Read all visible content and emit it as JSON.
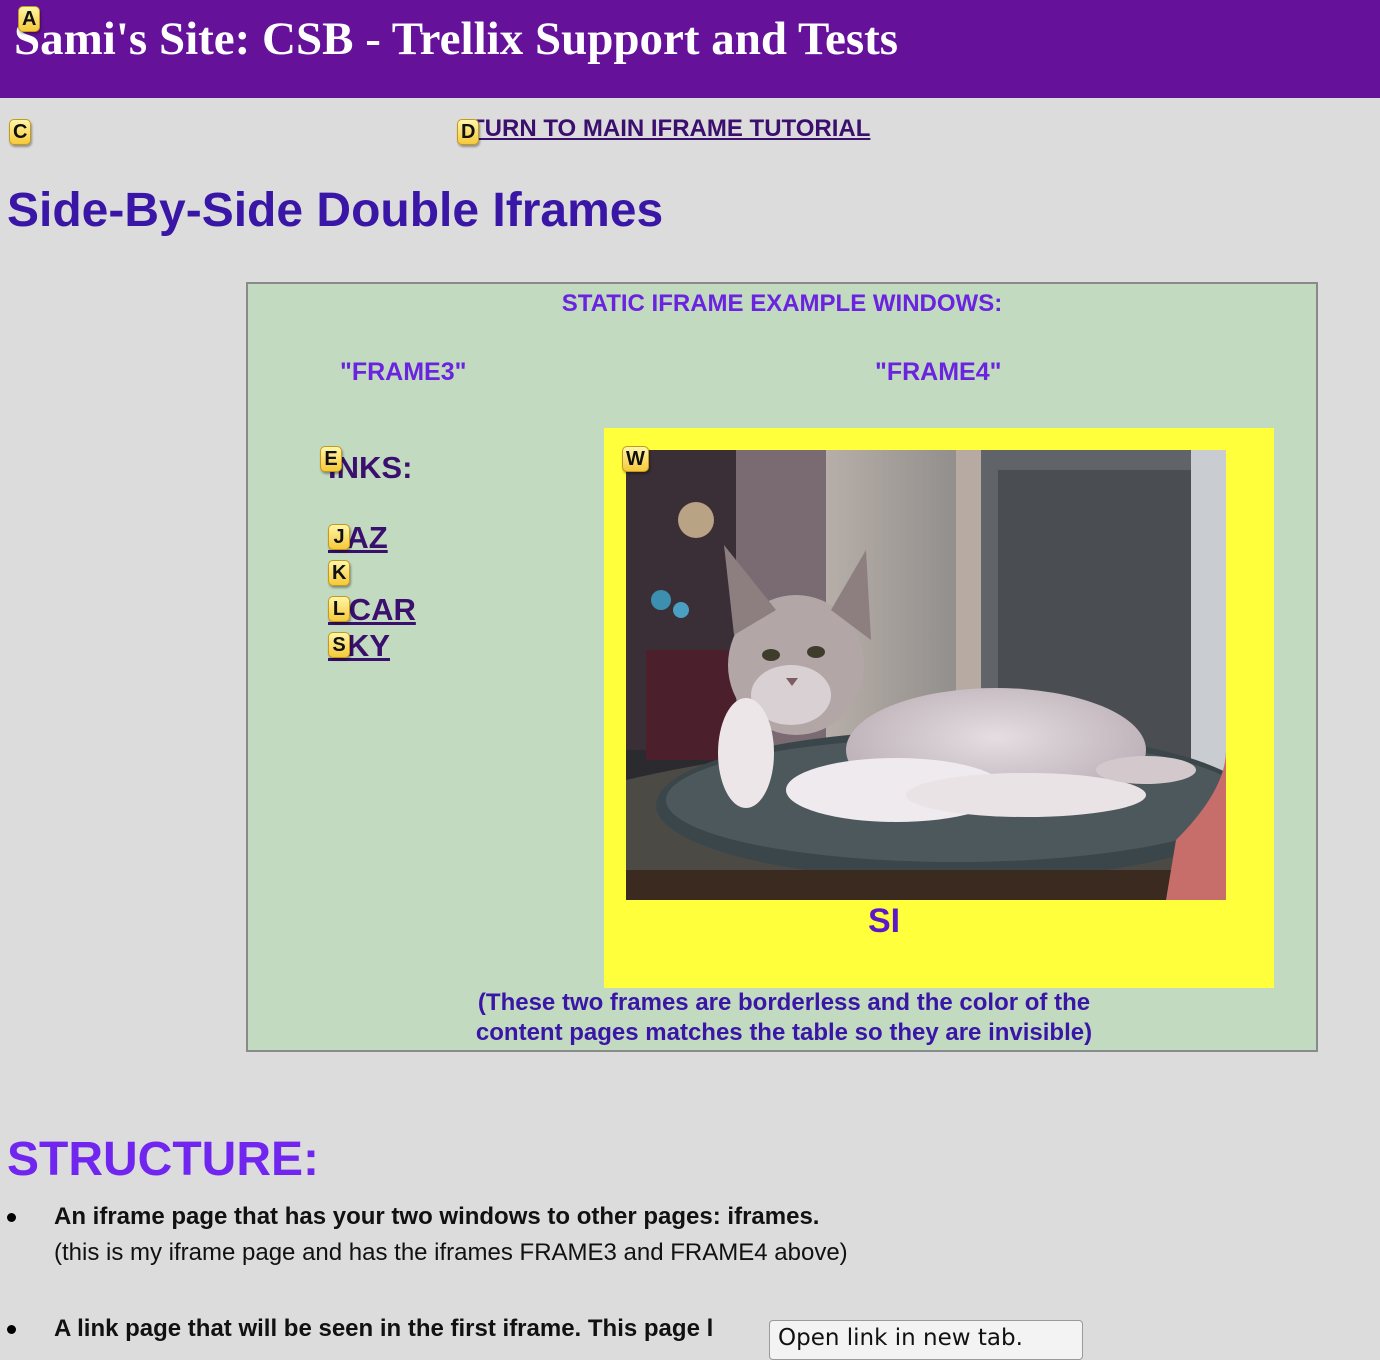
{
  "header": {
    "site_title": "Sami's Site: CSB - Trellix Support and Tests",
    "background_color": "#651199"
  },
  "hints": {
    "a": "A",
    "c": "C",
    "d": "D",
    "e": "E",
    "j": "J",
    "k": "K",
    "l": "L",
    "s": "S",
    "w": "W"
  },
  "nav": {
    "return_link": "TURN TO MAIN IFRAME TUTORIAL"
  },
  "page": {
    "heading": "Side-By-Side Double Iframes"
  },
  "example": {
    "title": "STATIC IFRAME EXAMPLE WINDOWS:",
    "frame3_label": "\"FRAME3\"",
    "frame4_label": "\"FRAME4\"",
    "links_heading": "INKS:",
    "links": [
      {
        "label": "PAZ"
      },
      {
        "label": ""
      },
      {
        "label": "SCAR"
      },
      {
        "label": "LKY"
      }
    ],
    "frame4_caption": "SI",
    "note_line1": "(These two frames are borderless and the color of the",
    "note_line2": "content pages matches the table so they are invisible)",
    "box_color": "#c2dac0",
    "frame4_color": "#ffff3b"
  },
  "structure": {
    "heading": "STRUCTURE:",
    "items": [
      {
        "main": "An iframe page that has your two windows to other pages: iframes.",
        "sub": "(this is my iframe page and has the iframes FRAME3 and FRAME4 above)"
      },
      {
        "main": "A link page that will be seen in the first iframe. This page l",
        "sub": ""
      }
    ]
  },
  "tooltip": {
    "text": "Open link in new tab."
  }
}
